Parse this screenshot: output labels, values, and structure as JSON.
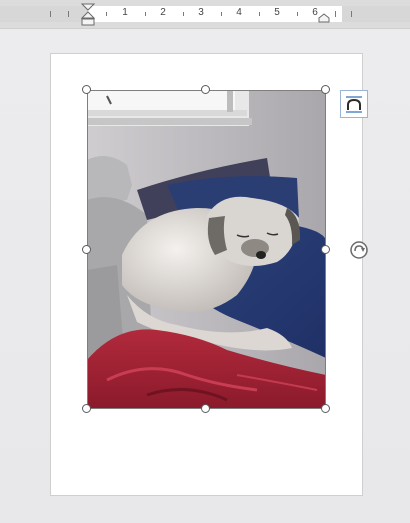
{
  "ruler": {
    "numbers": [
      "1",
      "2",
      "3",
      "4",
      "5",
      "6"
    ]
  },
  "image": {
    "description_icon": "photo-of-dog-on-pillows"
  },
  "icons": {
    "layout_options": "layout-options-icon",
    "rotate": "rotate-handle-icon"
  },
  "colors": {
    "ruler_bg": "#dcdcdc",
    "page_bg": "#ffffff",
    "canvas_bg": "#e9e9eb",
    "handle_border": "#5b5b5b",
    "layout_accent": "#2b6cb8"
  }
}
